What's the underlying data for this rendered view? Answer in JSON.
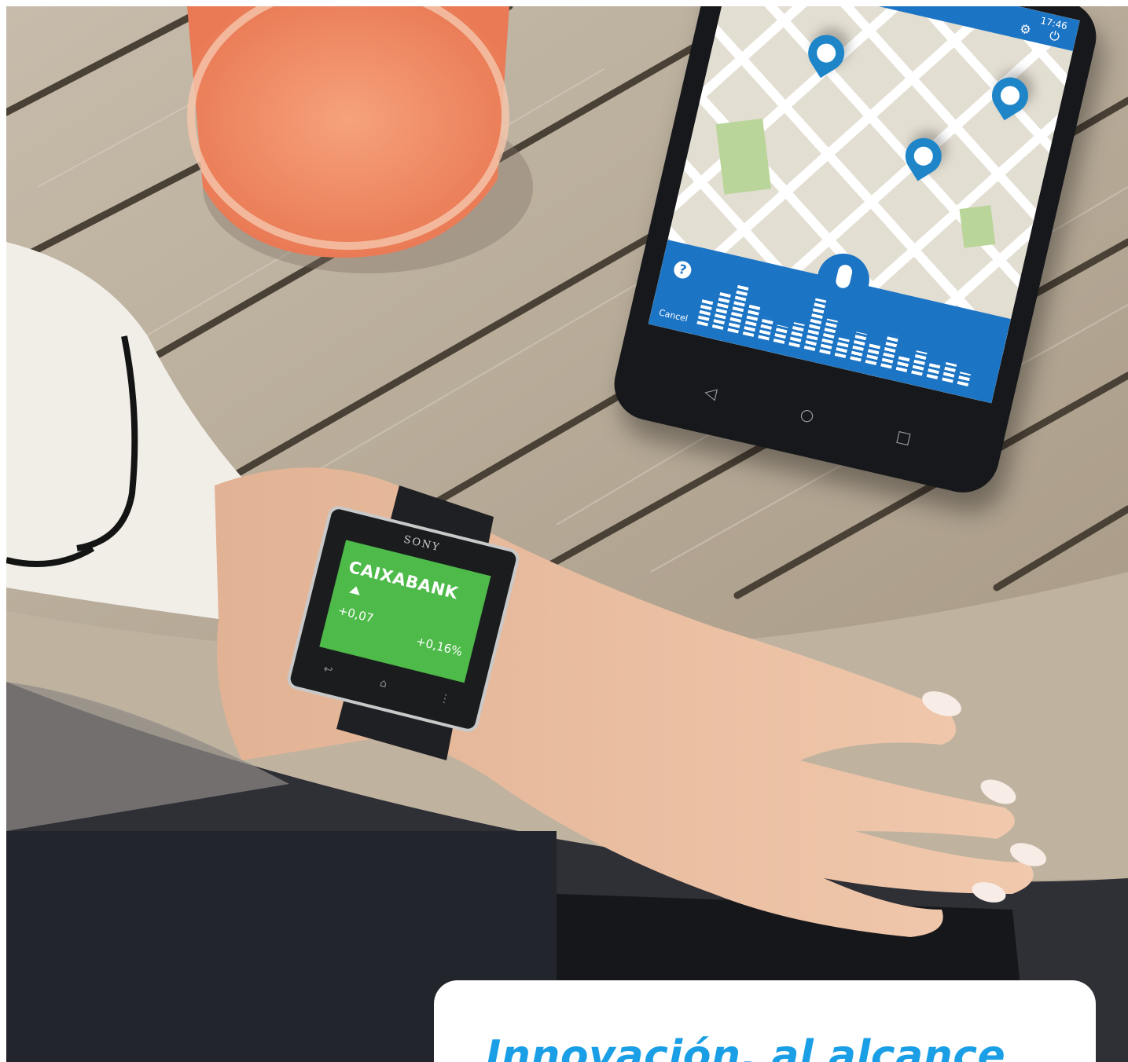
{
  "scene": {
    "table_color": "#b6aa98",
    "juice_color": "#f28a63"
  },
  "phone": {
    "status_time": "17:46",
    "accent_color": "#1c74c4",
    "topbar_icons": [
      "gear-icon",
      "power-icon"
    ],
    "help_icon": "question-icon",
    "mic_icon": "microphone-icon",
    "cancel_label": "Cancel",
    "nav_icons": [
      "back-icon",
      "home-icon",
      "recent-apps-icon"
    ]
  },
  "watch": {
    "brand": "SONY",
    "title": "CAIXABANK",
    "value": "+0,07",
    "percent": "+0,16%",
    "screen_color": "#4dba49"
  },
  "caption": {
    "text": "Innovación, al alcance",
    "color": "#1a9fe6"
  }
}
